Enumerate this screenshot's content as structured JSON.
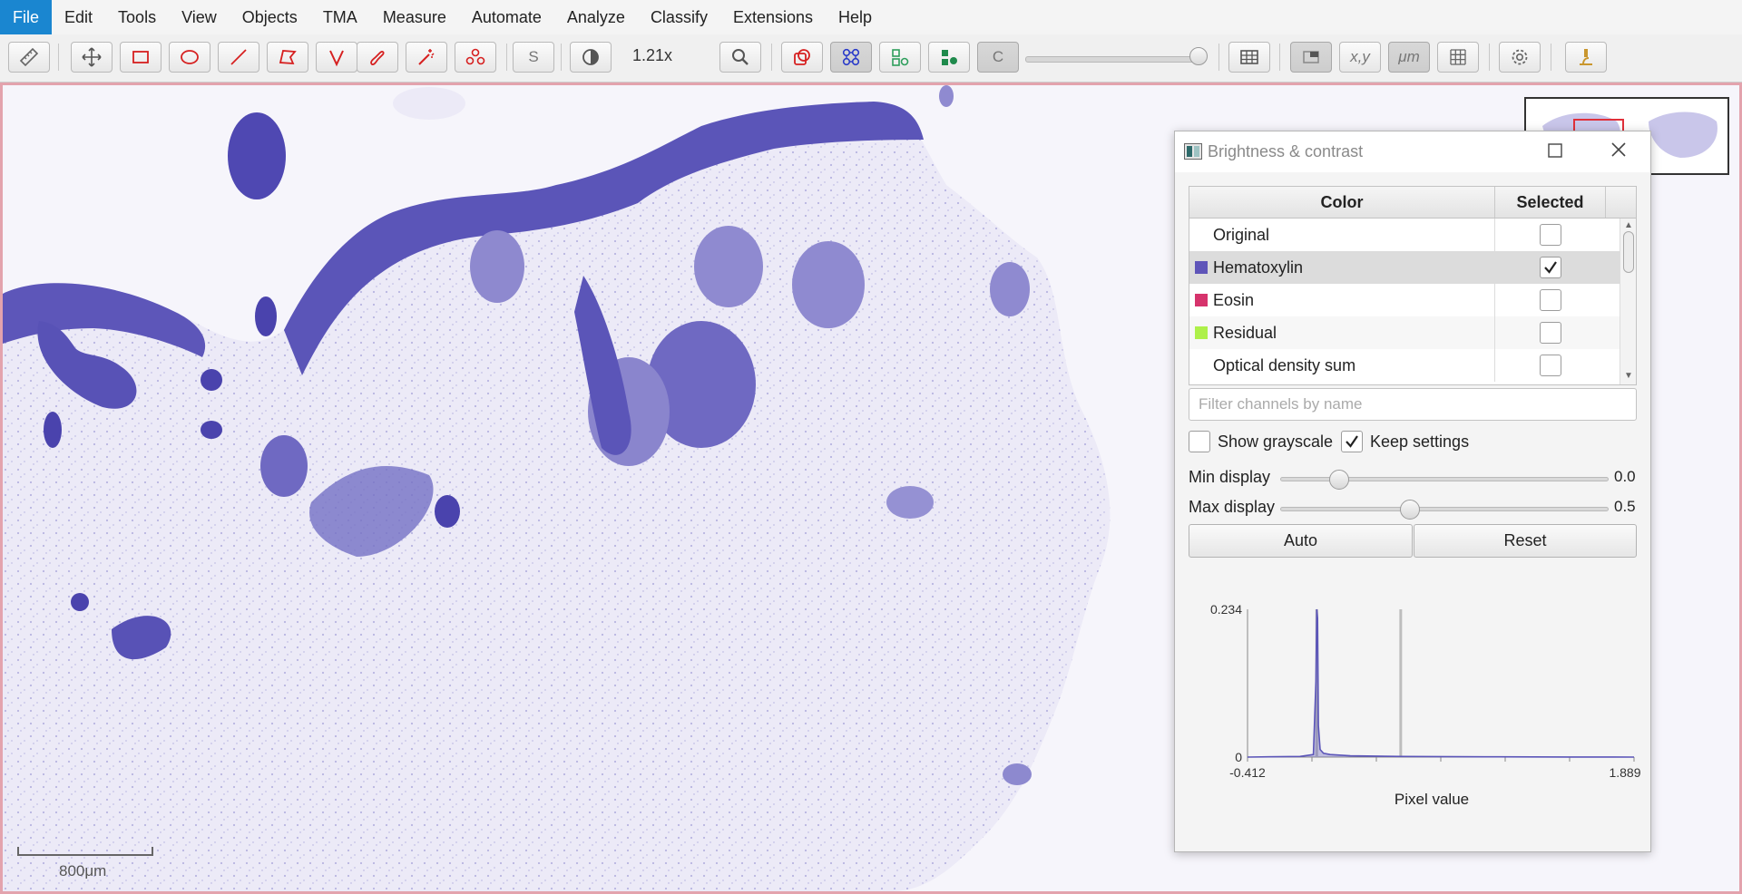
{
  "menu": [
    "File",
    "Edit",
    "Tools",
    "View",
    "Objects",
    "TMA",
    "Measure",
    "Automate",
    "Analyze",
    "Classify",
    "Extensions",
    "Help"
  ],
  "toolbar": {
    "zoom": "1.21x",
    "s_label": "S",
    "c_label": "C",
    "xy_label": "x,y",
    "um_label": "μm",
    "opacity_slider_value": 1.0
  },
  "viewer": {
    "scalebar_label": "800μm",
    "stain_color": "#5b55b8",
    "border_color": "#e3a3ad"
  },
  "dialog": {
    "title": "Brightness & contrast",
    "table": {
      "headers": {
        "color": "Color",
        "selected": "Selected"
      },
      "rows": [
        {
          "label": "Original",
          "swatch": "",
          "selected": false
        },
        {
          "label": "Hematoxylin",
          "swatch": "#5f55b9",
          "selected": true
        },
        {
          "label": "Eosin",
          "swatch": "#d6336c",
          "selected": false
        },
        {
          "label": "Residual",
          "swatch": "#aef04a",
          "selected": false
        },
        {
          "label": "Optical density sum",
          "swatch": "",
          "selected": false
        }
      ]
    },
    "filter_placeholder": "Filter channels by name",
    "show_grayscale": {
      "label": "Show grayscale",
      "checked": false
    },
    "keep_settings": {
      "label": "Keep settings",
      "checked": true
    },
    "min_display": {
      "label": "Min display",
      "value": "0.0",
      "level": 0.0
    },
    "max_display": {
      "label": "Max display",
      "value": "0.5",
      "level": 0.5
    },
    "auto_label": "Auto",
    "reset_label": "Reset"
  },
  "chart_data": {
    "type": "line",
    "title": "",
    "xlabel": "Pixel value",
    "ylabel": "",
    "xlim": [
      -0.412,
      1.889
    ],
    "ylim": [
      0,
      0.234
    ],
    "x_tick_labels": [
      "-0.412",
      "1.889"
    ],
    "y_tick_labels": [
      "0",
      "0.234"
    ],
    "series": [
      {
        "color": "#5b55b8",
        "x": [
          -0.412,
          -0.1,
          -0.02,
          -0.005,
          0.0,
          0.005,
          0.01,
          0.02,
          0.04,
          0.08,
          0.2,
          0.5,
          1.0,
          1.5,
          1.889
        ],
        "y": [
          0,
          0.001,
          0.004,
          0.12,
          0.234,
          0.22,
          0.05,
          0.012,
          0.006,
          0.004,
          0.002,
          0.001,
          0.0005,
          0.0002,
          0
        ]
      }
    ],
    "markers": [
      {
        "name": "min",
        "x": 0.0
      },
      {
        "name": "max",
        "x": 0.5
      }
    ]
  }
}
